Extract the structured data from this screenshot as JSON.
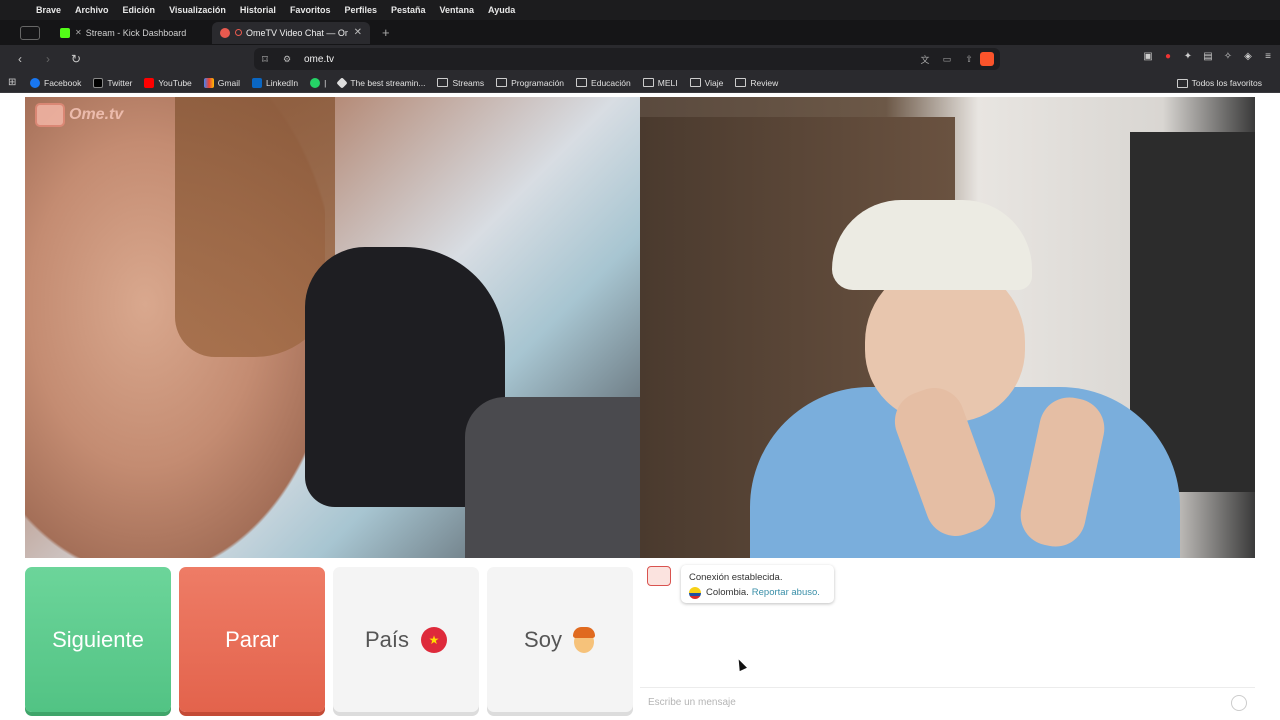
{
  "menubar": {
    "items": [
      "Brave",
      "Archivo",
      "Edición",
      "Visualización",
      "Historial",
      "Favoritos",
      "Perfiles",
      "Pestaña",
      "Ventana",
      "Ayuda"
    ]
  },
  "tabs": [
    {
      "title": "Stream - Kick Dashboard",
      "active": false
    },
    {
      "title": "OmeTV Video Chat — Omeg",
      "active": true
    }
  ],
  "toolbar": {
    "url": "ome.tv"
  },
  "bookmarks": {
    "items": [
      "Facebook",
      "Twitter",
      "YouTube",
      "Gmail",
      "LinkedIn",
      "|",
      "The best streamin...",
      "Streams",
      "Programación",
      "Educación",
      "MELI",
      "Viaje",
      "Review"
    ],
    "all_label": "Todos los favoritos"
  },
  "video": {
    "logo_text": "Ome.tv"
  },
  "buttons": {
    "next_label": "Siguiente",
    "stop_label": "Parar",
    "country_label": "País",
    "country_flag": "★",
    "gender_label": "Soy"
  },
  "chat": {
    "status": "Conexión establecida.",
    "country": "Colombia.",
    "report_link": "Reportar abuso.",
    "input_placeholder": "Escribe un mensaje"
  },
  "colors": {
    "next": "#52c384",
    "stop": "#e3634c",
    "link": "#3a8fa8"
  }
}
